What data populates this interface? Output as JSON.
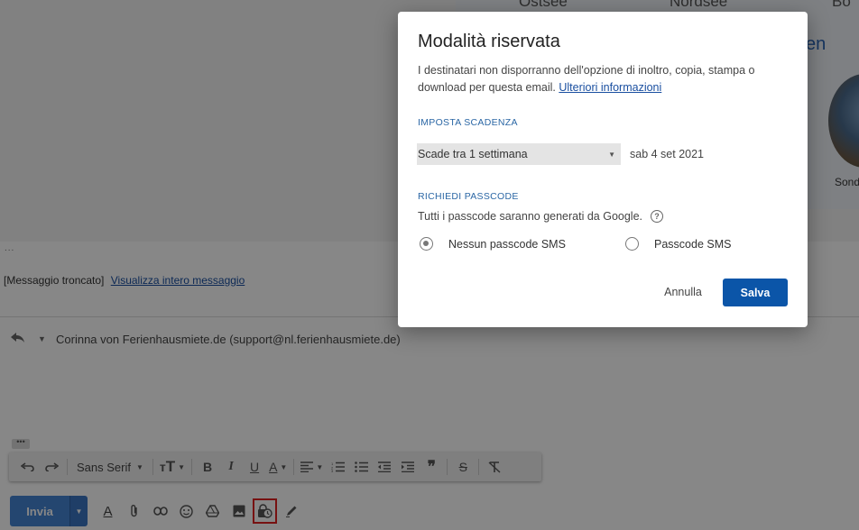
{
  "background": {
    "top_cut_words": [
      "Ostsee",
      "Nordsee",
      "Bo"
    ],
    "right_panel_cut_text": "en",
    "right_panel_caption": "Sond",
    "ellipsis": "...",
    "truncated_label": "[Messaggio troncato]",
    "view_full_link": "Visualizza intero messaggio",
    "reply_to": "Corinna von Ferienhausmiete.de (support@nl.ferienhausmiete.de)",
    "more_dots": "•••"
  },
  "format_toolbar": {
    "font_name": "Sans Serif",
    "icons": [
      "undo-icon",
      "redo-icon",
      "font-family-select",
      "text-size-icon",
      "bold-icon",
      "italic-icon",
      "underline-icon",
      "text-color-icon",
      "align-icon",
      "numbered-list-icon",
      "bulleted-list-icon",
      "indent-less-icon",
      "indent-more-icon",
      "quote-icon",
      "strikethrough-icon",
      "remove-formatting-icon"
    ]
  },
  "send_bar": {
    "send_label": "Invia",
    "icons": [
      "formatting-options-icon",
      "attach-icon",
      "link-icon",
      "emoji-icon",
      "drive-icon",
      "photo-icon",
      "confidential-mode-icon",
      "signature-icon"
    ],
    "highlighted": "confidential-mode-icon",
    "highlight_color": "#e02020"
  },
  "dialog": {
    "title": "Modalità riservata",
    "description": "I destinatari non disporranno dell'opzione di inoltro, copia, stampa o download per questa email.",
    "learn_more": "Ulteriori informazioni",
    "expiry_section": "IMPOSTA SCADENZA",
    "expiry_selected": "Scade tra 1 settimana",
    "expiry_date": "sab 4 set 2021",
    "passcode_section": "RICHIEDI PASSCODE",
    "passcode_note": "Tutti i passcode saranno generati da Google.",
    "options": [
      {
        "label": "Nessun passcode SMS",
        "selected": true
      },
      {
        "label": "Passcode SMS",
        "selected": false
      }
    ],
    "cancel_label": "Annulla",
    "save_label": "Salva",
    "accent_color": "#0b55a8",
    "section_color": "#2b67a5"
  }
}
